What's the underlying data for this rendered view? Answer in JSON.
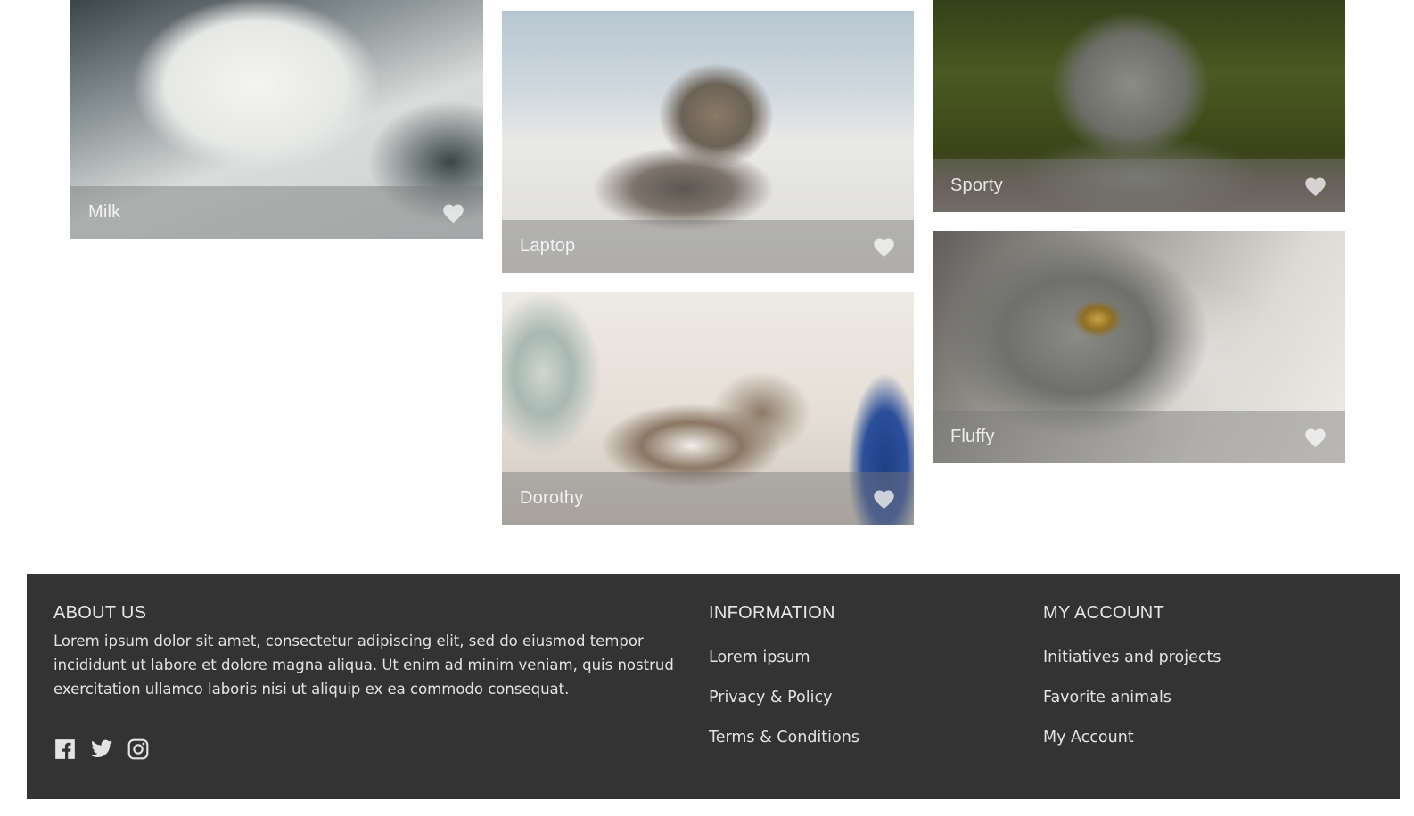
{
  "gallery": {
    "cards": [
      {
        "name": "Milk"
      },
      {
        "name": "Laptop"
      },
      {
        "name": "Dorothy"
      },
      {
        "name": "Sporty"
      },
      {
        "name": "Fluffy"
      }
    ]
  },
  "footer": {
    "about": {
      "heading": "ABOUT US",
      "text": "Lorem ipsum dolor sit amet, consectetur adipiscing elit, sed do eiusmod tempor incididunt ut labore et dolore magna aliqua. Ut enim ad minim veniam, quis nostrud exercitation ullamco laboris nisi ut aliquip ex ea commodo consequat.",
      "social_icons": [
        "facebook-icon",
        "twitter-icon",
        "instagram-icon"
      ]
    },
    "information": {
      "heading": "INFORMATION",
      "links": [
        "Lorem ipsum",
        "Privacy & Policy",
        "Terms & Conditions"
      ]
    },
    "account": {
      "heading": "MY ACCOUNT",
      "links": [
        "Initiatives and projects",
        "Favorite animals",
        "My Account"
      ]
    }
  },
  "colors": {
    "footer_background": "#333333",
    "footer_text": "#e3e3e3",
    "caption_overlay": "rgba(120,120,120,0.45)"
  }
}
